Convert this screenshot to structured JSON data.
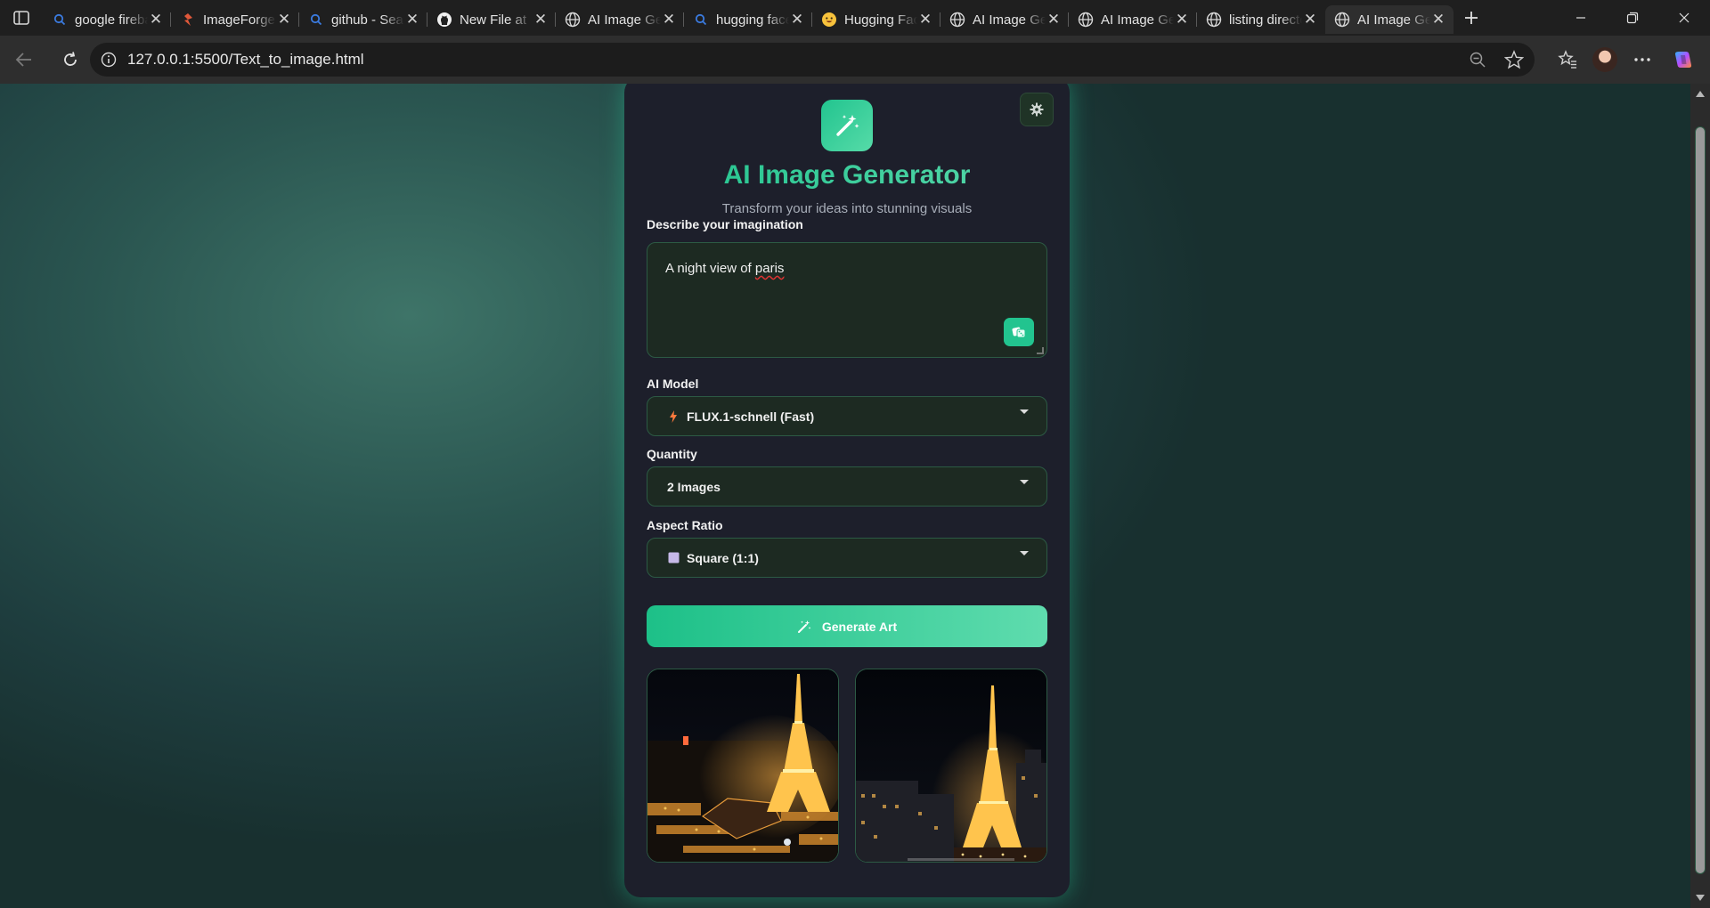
{
  "browser": {
    "tabs": [
      {
        "title": "google firebase",
        "icon": "search-icon"
      },
      {
        "title": "ImageForge",
        "icon": "imageforge-icon"
      },
      {
        "title": "github - Search",
        "icon": "search-icon"
      },
      {
        "title": "New File at",
        "icon": "github-icon"
      },
      {
        "title": "AI Image Generator",
        "icon": "globe-icon"
      },
      {
        "title": "hugging face",
        "icon": "search-icon"
      },
      {
        "title": "Hugging Face",
        "icon": "hugging-face-icon"
      },
      {
        "title": "AI Image Generator",
        "icon": "globe-icon"
      },
      {
        "title": "AI Image Generator",
        "icon": "globe-icon"
      },
      {
        "title": "listing directory",
        "icon": "globe-icon"
      },
      {
        "title": "AI Image Generator",
        "icon": "globe-icon",
        "active": true
      }
    ],
    "url": "127.0.0.1:5500/Text_to_image.html"
  },
  "app": {
    "title": "AI Image Generator",
    "subtitle": "Transform your ideas into stunning visuals",
    "accent_color": "#22c48f",
    "prompt": {
      "label": "Describe your imagination",
      "value_start": "A night view of ",
      "value_misspelled": "paris"
    },
    "model": {
      "label": "AI Model",
      "selected": "FLUX.1-schnell (Fast)",
      "icon": "lightning-icon"
    },
    "quantity": {
      "label": "Quantity",
      "selected": "2 Images"
    },
    "aspect_ratio": {
      "label": "Aspect Ratio",
      "selected": "Square (1:1)",
      "icon": "square-icon"
    },
    "generate_label": "Generate Art",
    "gallery": [
      {
        "subject": "Eiffel Tower at night, aerial with rooftops"
      },
      {
        "subject": "Eiffel Tower at night, city skyline"
      }
    ]
  }
}
